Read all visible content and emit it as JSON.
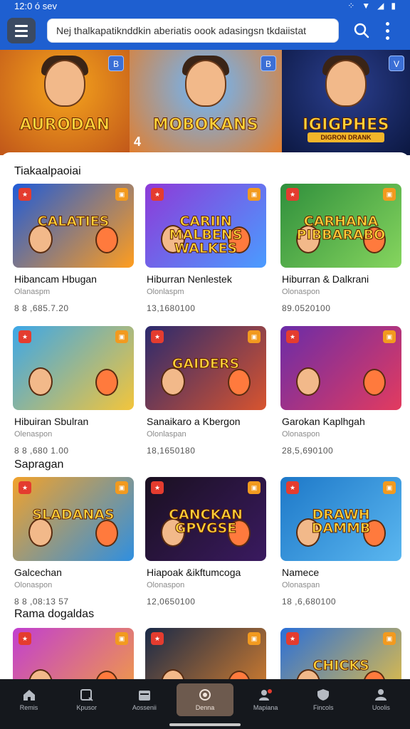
{
  "status": {
    "time": "12:0 ó sev"
  },
  "search": {
    "placeholder": "Nej thalkapatiknddkin aberiatis oook adasingsn tkdaiistat"
  },
  "hero": [
    {
      "title": "AURODAN",
      "subtitle": "",
      "badge": "B",
      "number": "",
      "colors": [
        "#f6a51c",
        "#c0561a"
      ]
    },
    {
      "title": "MOBOKANS",
      "subtitle": "",
      "badge": "B",
      "number": "4",
      "colors": [
        "#6ab7ff",
        "#e47d2a"
      ]
    },
    {
      "title": "IGIGPHES",
      "subtitle": "DIGRON DRANK",
      "badge": "V",
      "number": "",
      "colors": [
        "#2b3f8f",
        "#0b1740"
      ]
    }
  ],
  "sections": [
    {
      "title": "Tiakaalpaoiai",
      "cards": [
        {
          "art": "CALATIES",
          "name": "Hibancam Hbugan",
          "sub": "Olanaspm",
          "num": "8 8 ,685.7.20",
          "colors": [
            "#1f5bd8",
            "#ff9d1e"
          ]
        },
        {
          "art": "CARIIN MALBENS WALKES",
          "name": "Hiburran Nenlestek",
          "sub": "Olonlaspm",
          "num": "13,1680100",
          "colors": [
            "#8e3ad8",
            "#4a9cff"
          ]
        },
        {
          "art": "CARHANA PIBBARABO",
          "name": "Hiburran & Dalkrani",
          "sub": "Olonaspon",
          "num": "89.0520100",
          "colors": [
            "#2f8f3c",
            "#86d55e"
          ]
        }
      ]
    },
    {
      "title": "",
      "cards": [
        {
          "art": "",
          "name": "Hibuiran Sbulran",
          "sub": "Olenaspon",
          "num": "8 8 ,680 1.00",
          "colors": [
            "#3ca7e8",
            "#f3c53b"
          ]
        },
        {
          "art": "GAIDERS",
          "name": "Sanaikaro a Kbergon",
          "sub": "Olonlaspan",
          "num": "18,1650180",
          "colors": [
            "#2b2a6e",
            "#d8542f"
          ]
        },
        {
          "art": "",
          "name": "Garokan Kaplhgah",
          "sub": "Olonaspon",
          "num": "28,5,690100",
          "colors": [
            "#6a2ca8",
            "#e33b5f"
          ]
        }
      ]
    },
    {
      "title": "Sapragan",
      "cards": [
        {
          "art": "SLADANAS",
          "name": "Galcechan",
          "sub": "Olonaspon",
          "num": "8 8 ,08:13 57",
          "colors": [
            "#f2a22b",
            "#2f8fe0"
          ]
        },
        {
          "art": "CANCKAN GPVGSE",
          "name": "Hiapoak &ikftumcoga",
          "sub": "Olonaspon",
          "num": "12,0650100",
          "colors": [
            "#1a1020",
            "#3a1a60"
          ]
        },
        {
          "art": "DRAWH DAMMB",
          "name": "Namece",
          "sub": "Olonaspan",
          "num": "18 ,6,680100",
          "colors": [
            "#1d78c8",
            "#5bb7f0"
          ]
        }
      ]
    },
    {
      "title": "Rama dogaldas",
      "cards": [
        {
          "art": "",
          "name": "",
          "sub": "",
          "num": "",
          "colors": [
            "#c13fd0",
            "#f5a33a"
          ]
        },
        {
          "art": "",
          "name": "",
          "sub": "",
          "num": "",
          "colors": [
            "#1a2a48",
            "#e3852c"
          ]
        },
        {
          "art": "CHICKS",
          "name": "",
          "sub": "",
          "num": "",
          "colors": [
            "#2a6fd8",
            "#f2c43a"
          ]
        }
      ]
    }
  ],
  "nav": [
    {
      "label": "Remis",
      "icon": "home-icon",
      "active": false
    },
    {
      "label": "Kpusor",
      "icon": "search-square-icon",
      "active": false
    },
    {
      "label": "Aossenii",
      "icon": "calendar-icon",
      "active": false
    },
    {
      "label": "Denna",
      "icon": "record-icon",
      "active": true
    },
    {
      "label": "Mapiana",
      "icon": "people-icon",
      "active": false
    },
    {
      "label": "Fincols",
      "icon": "shield-icon",
      "active": false
    },
    {
      "label": "Uoolis",
      "icon": "person-icon",
      "active": false
    }
  ],
  "colors": {
    "brand_blue": "#1e5fd0",
    "nav_bg": "#15181d",
    "nav_active": "#6d5a4e"
  }
}
